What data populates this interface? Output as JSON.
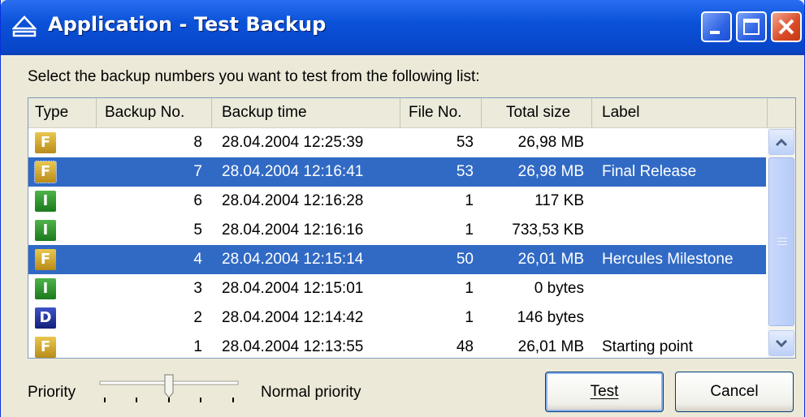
{
  "window": {
    "title": "Application - Test Backup",
    "controls": [
      "minimize-icon",
      "maximize-icon",
      "close-icon"
    ]
  },
  "instruction": "Select the backup numbers you want to test from the following list:",
  "list": {
    "columns": [
      "Type",
      "Backup No.",
      "Backup time",
      "File No.",
      "Total size",
      "Label"
    ],
    "rows": [
      {
        "type": "F",
        "backup_no": "8",
        "time": "28.04.2004 12:25:39",
        "file_no": "53",
        "size": "26,98 MB",
        "label": "",
        "selected": false
      },
      {
        "type": "F",
        "backup_no": "7",
        "time": "28.04.2004 12:16:41",
        "file_no": "53",
        "size": "26,98 MB",
        "label": "Final Release",
        "selected": true
      },
      {
        "type": "I",
        "backup_no": "6",
        "time": "28.04.2004 12:16:28",
        "file_no": "1",
        "size": "117 KB",
        "label": "",
        "selected": false
      },
      {
        "type": "I",
        "backup_no": "5",
        "time": "28.04.2004 12:16:16",
        "file_no": "1",
        "size": "733,53 KB",
        "label": "",
        "selected": false
      },
      {
        "type": "F",
        "backup_no": "4",
        "time": "28.04.2004 12:15:14",
        "file_no": "50",
        "size": "26,01 MB",
        "label": "Hercules Milestone",
        "selected": true
      },
      {
        "type": "I",
        "backup_no": "3",
        "time": "28.04.2004 12:15:01",
        "file_no": "1",
        "size": "0 bytes",
        "label": "",
        "selected": false
      },
      {
        "type": "D",
        "backup_no": "2",
        "time": "28.04.2004 12:14:42",
        "file_no": "1",
        "size": "146 bytes",
        "label": "",
        "selected": false
      },
      {
        "type": "F",
        "backup_no": "1",
        "time": "28.04.2004 12:13:55",
        "file_no": "48",
        "size": "26,01 MB",
        "label": "Starting point",
        "selected": false
      }
    ]
  },
  "priority": {
    "label": "Priority",
    "value_text": "Normal priority",
    "level": 2,
    "levels": 5
  },
  "buttons": {
    "test": "Test",
    "cancel": "Cancel"
  },
  "colors": {
    "title_bar": "#0a52d9",
    "selection": "#316ac5",
    "type_full": "#c99b26",
    "type_incremental": "#2e8f2c",
    "type_differential": "#1f2f9e"
  }
}
